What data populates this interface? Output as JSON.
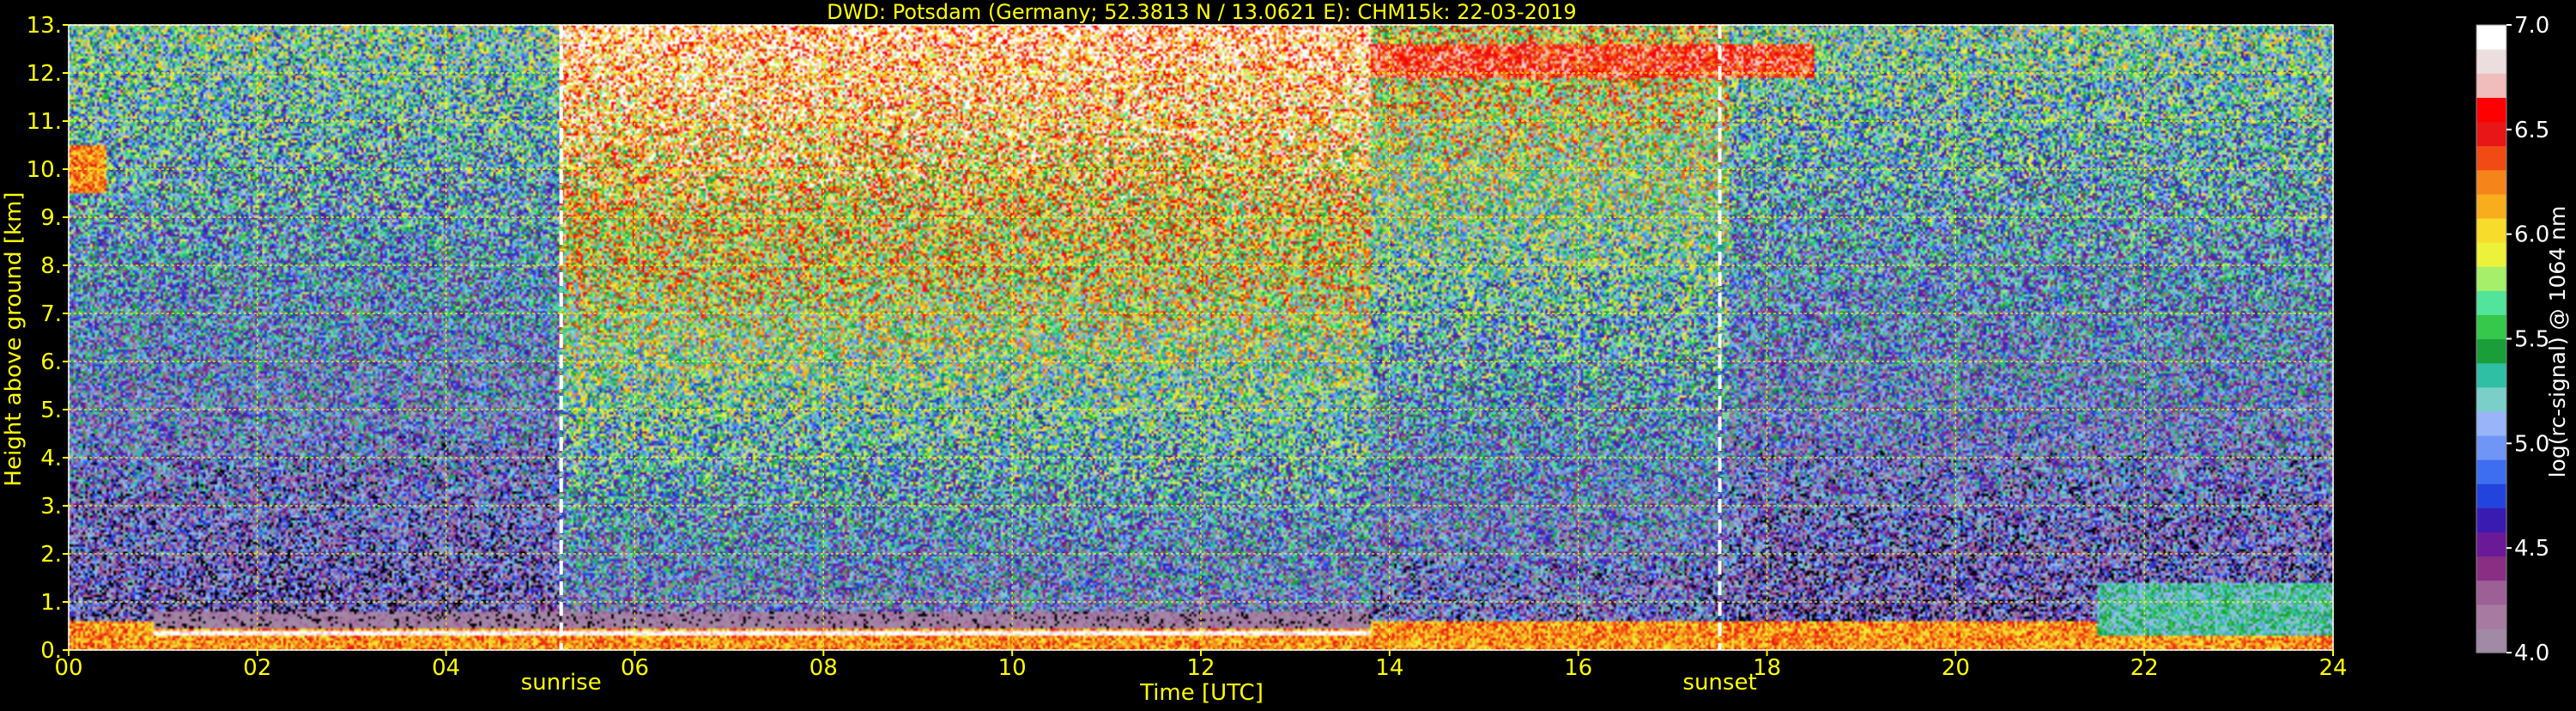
{
  "chart_data": {
    "type": "heatmap",
    "title": "DWD: Potsdam (Germany; 52.3813 N / 13.0621 E):    CHM15k: 22-03-2019",
    "xlabel": "Time [UTC]",
    "ylabel": "Height above ground [km]",
    "colorbar_label": "log(rc-signal) @ 1064 nm",
    "xlim": [
      0,
      24
    ],
    "ylim": [
      0,
      13
    ],
    "x_ticks": [
      0,
      2,
      4,
      6,
      8,
      10,
      12,
      14,
      16,
      18,
      20,
      22,
      24
    ],
    "x_tick_labels": [
      "00",
      "02",
      "04",
      "06",
      "08",
      "10",
      "12",
      "14",
      "16",
      "18",
      "20",
      "22",
      "24"
    ],
    "y_ticks": [
      0,
      1,
      2,
      3,
      4,
      5,
      6,
      7,
      8,
      9,
      10,
      11,
      12,
      13
    ],
    "y_tick_labels": [
      "0.",
      "1.",
      "2.",
      "3.",
      "4.",
      "5.",
      "6.",
      "7.",
      "8.",
      "9.",
      "10.",
      "11.",
      "12.",
      "13."
    ],
    "grid": true,
    "color_range": [
      4.0,
      7.0
    ],
    "colorbar_ticks": [
      4.0,
      4.5,
      5.0,
      5.5,
      6.0,
      6.5,
      7.0
    ],
    "colorbar_tick_labels": [
      "4.0",
      "4.5",
      "5.0",
      "5.5",
      "6.0",
      "6.5",
      "7.0"
    ],
    "annotations": [
      {
        "label": "sunrise",
        "x": 5.22
      },
      {
        "label": "sunset",
        "x": 17.5
      }
    ],
    "colors": {
      "background": "#000000",
      "text": "#ffff00",
      "grid": "#ffff00",
      "colorbar_text": "#ffffff",
      "marker_line": "#ffffff"
    },
    "colormap": [
      "#a08aa6",
      "#a77aa1",
      "#9c5f96",
      "#882f84",
      "#6a1a96",
      "#3a1bb2",
      "#2244dd",
      "#3d6ef0",
      "#6f95f6",
      "#99b4f8",
      "#7acfc9",
      "#2fbfa5",
      "#1a9e3a",
      "#35c84a",
      "#52e49a",
      "#a6ef6a",
      "#ecf23a",
      "#f7dc2b",
      "#f7ad1c",
      "#f5851a",
      "#f14a14",
      "#e81616",
      "#ff0000",
      "#f1bcbc",
      "#ecdede",
      "#ffffff"
    ],
    "features": [
      {
        "name": "boundary-layer-signal",
        "x": [
          0,
          24
        ],
        "y": [
          0,
          0.6
        ],
        "value": 6.2
      },
      {
        "name": "cloud-base-return",
        "x": [
          0.9,
          13.8
        ],
        "y": [
          0.3,
          0.4
        ],
        "value": 7.0
      },
      {
        "name": "signal-gap",
        "x": [
          0.9,
          13.8
        ],
        "y": [
          0.45,
          0.8
        ],
        "value": 4.0
      },
      {
        "name": "cirrus-layer",
        "x": [
          13.8,
          18.5
        ],
        "y": [
          11.9,
          12.6
        ],
        "value": 6.5
      },
      {
        "name": "aerosol-plume",
        "x": [
          21.5,
          24
        ],
        "y": [
          0.3,
          1.4
        ],
        "value": 5.3
      },
      {
        "name": "early-cloud",
        "x": [
          0,
          0.4
        ],
        "y": [
          9.5,
          10.5
        ],
        "value": 6.2
      }
    ]
  }
}
